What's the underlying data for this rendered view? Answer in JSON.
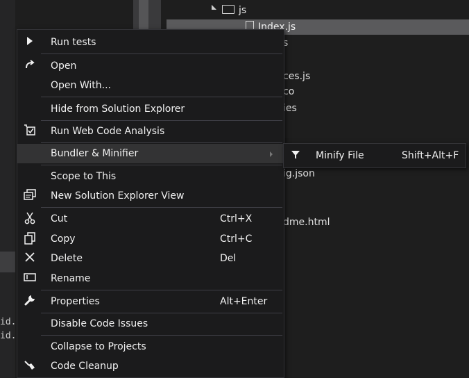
{
  "explorer": {
    "folder_js": "js",
    "selected_file": "Index.js",
    "fragments": [
      "s",
      "ces.js",
      "co",
      "ies",
      "ig.json",
      "dme.html"
    ],
    "left_fragments": [
      "id.",
      "id."
    ]
  },
  "menu": {
    "items": [
      {
        "label": "Run tests",
        "icon": "play-icon",
        "shortcut": ""
      },
      {
        "label": "Open",
        "icon": "open-arrow-icon",
        "shortcut": ""
      },
      {
        "label": "Open With...",
        "icon": "",
        "shortcut": ""
      },
      {
        "label": "Hide from Solution Explorer",
        "icon": "",
        "shortcut": ""
      },
      {
        "label": "Run Web Code Analysis",
        "icon": "code-analysis-icon",
        "shortcut": ""
      },
      {
        "label": "Bundler & Minifier",
        "icon": "",
        "shortcut": ""
      },
      {
        "label": "Scope to This",
        "icon": "",
        "shortcut": ""
      },
      {
        "label": "New Solution Explorer View",
        "icon": "new-explorer-view-icon",
        "shortcut": ""
      },
      {
        "label": "Cut",
        "icon": "scissors-icon",
        "shortcut": "Ctrl+X"
      },
      {
        "label": "Copy",
        "icon": "copy-icon",
        "shortcut": "Ctrl+C"
      },
      {
        "label": "Delete",
        "icon": "delete-x-icon",
        "shortcut": "Del"
      },
      {
        "label": "Rename",
        "icon": "rename-icon",
        "shortcut": ""
      },
      {
        "label": "Properties",
        "icon": "wrench-icon",
        "shortcut": "Alt+Enter"
      },
      {
        "label": "Disable Code Issues",
        "icon": "",
        "shortcut": ""
      },
      {
        "label": "Collapse to Projects",
        "icon": "",
        "shortcut": ""
      },
      {
        "label": "Code Cleanup",
        "icon": "broom-icon",
        "shortcut": ""
      }
    ]
  },
  "submenu": {
    "label": "Minify File",
    "shortcut": "Shift+Alt+F",
    "icon": "funnel-icon"
  },
  "colors": {
    "menu_bg": "#1b1b1c",
    "highlight": "#333334",
    "selected_tree_row": "#5a5a5c",
    "text": "#f1f1f1"
  }
}
